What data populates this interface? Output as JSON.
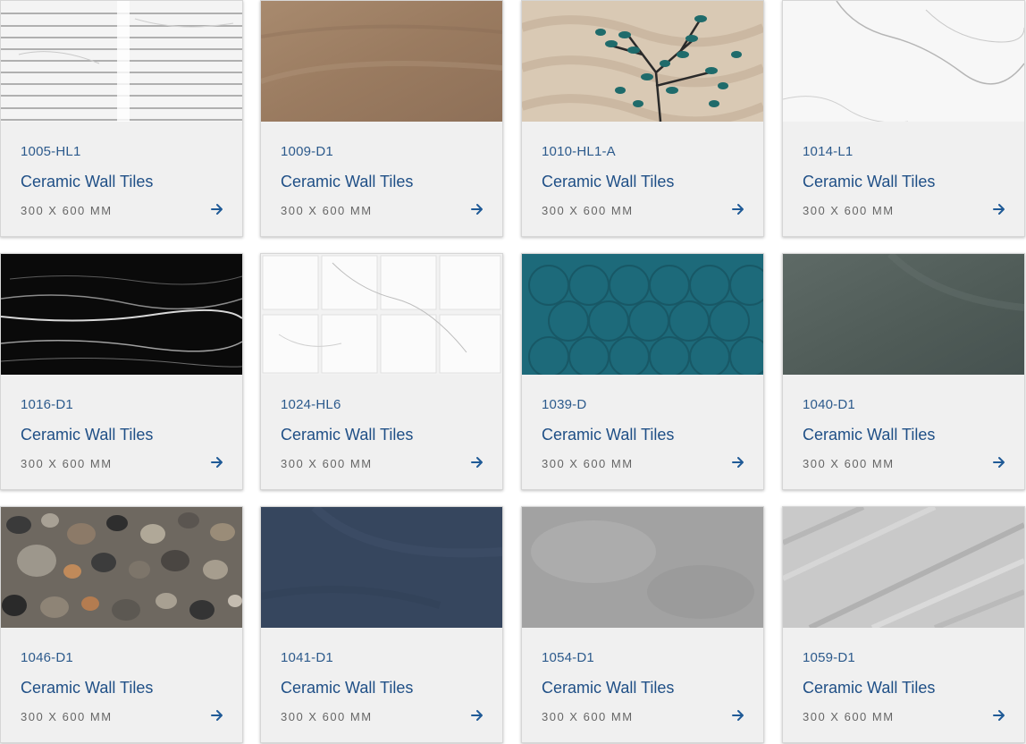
{
  "products": [
    {
      "code": "1005-HL1",
      "title": "Ceramic Wall Tiles",
      "size": "300 X 600 MM",
      "swatch": "white-linear-marble"
    },
    {
      "code": "1009-D1",
      "title": "Ceramic Wall Tiles",
      "size": "300 X 600 MM",
      "swatch": "sand-brown"
    },
    {
      "code": "1010-HL1-A",
      "title": "Ceramic Wall Tiles",
      "size": "300 X 600 MM",
      "swatch": "beige-wave-teal-tree"
    },
    {
      "code": "1014-L1",
      "title": "Ceramic Wall Tiles",
      "size": "300 X 600 MM",
      "swatch": "white-marble"
    },
    {
      "code": "1016-D1",
      "title": "Ceramic Wall Tiles",
      "size": "300 X 600 MM",
      "swatch": "black-marble"
    },
    {
      "code": "1024-HL6",
      "title": "Ceramic Wall Tiles",
      "size": "300 X 600 MM",
      "swatch": "white-marble-blocks"
    },
    {
      "code": "1039-D",
      "title": "Ceramic Wall Tiles",
      "size": "300 X 600 MM",
      "swatch": "teal-floral-pattern"
    },
    {
      "code": "1040-D1",
      "title": "Ceramic Wall Tiles",
      "size": "300 X 600 MM",
      "swatch": "slate-grey"
    },
    {
      "code": "1046-D1",
      "title": "Ceramic Wall Tiles",
      "size": "300 X 600 MM",
      "swatch": "terrazzo-stone"
    },
    {
      "code": "1041-D1",
      "title": "Ceramic Wall Tiles",
      "size": "300 X 600 MM",
      "swatch": "navy-blue"
    },
    {
      "code": "1054-D1",
      "title": "Ceramic Wall Tiles",
      "size": "300 X 600 MM",
      "swatch": "grey-cement"
    },
    {
      "code": "1059-D1",
      "title": "Ceramic Wall Tiles",
      "size": "300 X 600 MM",
      "swatch": "grey-travertine"
    }
  ],
  "colors": {
    "card_bg": "#f0f0f0",
    "code_text": "#2c5a8c",
    "title_text": "#1f4f86",
    "size_text": "#666666",
    "arrow": "#1f5a96"
  },
  "icons": {
    "card_action": "arrow-right-icon"
  }
}
